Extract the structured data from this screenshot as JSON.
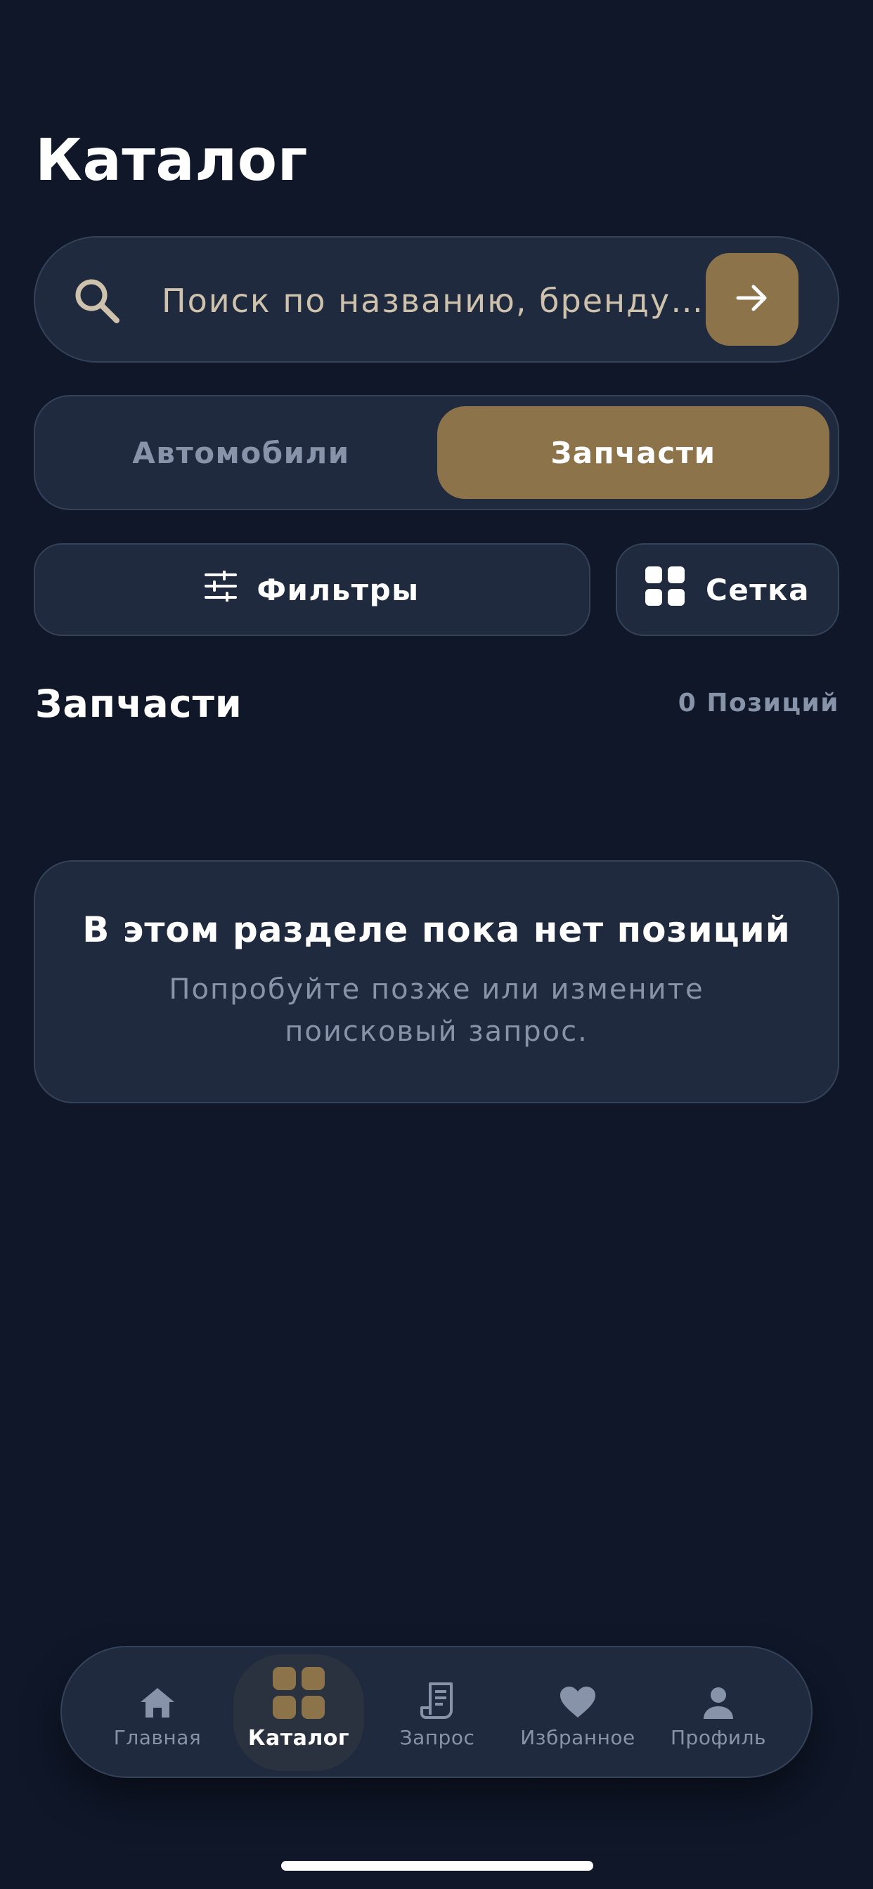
{
  "page": {
    "title": "Каталог"
  },
  "search": {
    "placeholder": "Поиск по названию, бренду…",
    "icon": "search-icon",
    "submit_icon": "arrow-right-icon"
  },
  "segments": {
    "cars_label": "Автомобили",
    "parts_label": "Запчасти",
    "selected": "Запчасти"
  },
  "toolbar": {
    "filters_label": "Фильтры",
    "filters_icon": "sliders-icon",
    "view_label": "Сетка",
    "view_icon": "grid-icon"
  },
  "section": {
    "title": "Запчасти",
    "count": "0 Позиций"
  },
  "empty_state": {
    "title": "В этом разделе пока нет позиций",
    "text": "Попробуйте позже или измените поисковый запрос."
  },
  "tabbar": {
    "items": [
      {
        "label": "Главная",
        "icon": "home-icon",
        "active": false
      },
      {
        "label": "Каталог",
        "icon": "catalog-grid-icon",
        "active": true
      },
      {
        "label": "Запрос",
        "icon": "receipt-icon",
        "active": false
      },
      {
        "label": "Избранное",
        "icon": "heart-icon",
        "active": false
      },
      {
        "label": "Профиль",
        "icon": "user-icon",
        "active": false
      }
    ]
  },
  "colors": {
    "background": "#0f1729",
    "surface": "#1f2a3e",
    "border": "#34425a",
    "accent": "#8d734a",
    "muted_text": "#8793a8",
    "search_text": "#cfc2ad"
  }
}
